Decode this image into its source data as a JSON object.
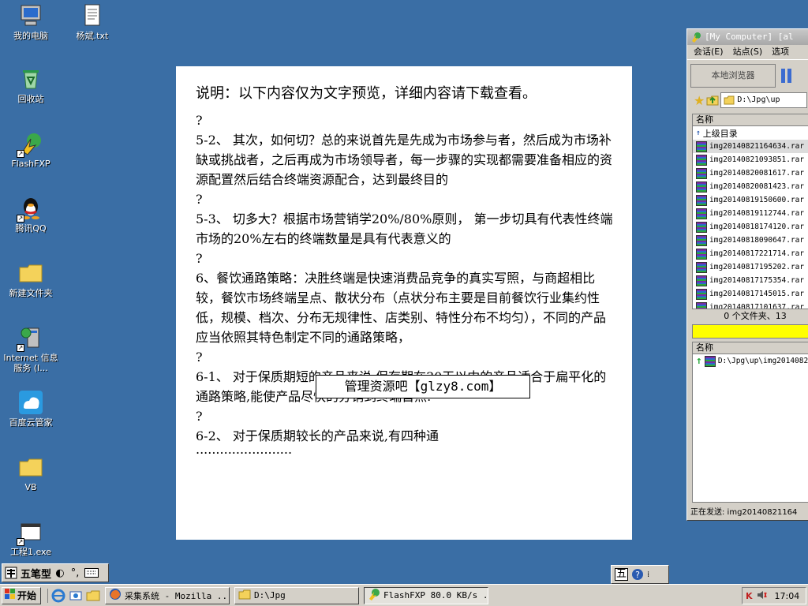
{
  "desktop": {
    "icons": [
      {
        "label": "我的电脑"
      },
      {
        "label": "杨斌.txt"
      },
      {
        "label": "回收站"
      },
      {
        "label": "FlashFXP"
      },
      {
        "label": "腾讯QQ"
      },
      {
        "label": "新建文件夹"
      },
      {
        "label": "Internet 信息服务 (I..."
      },
      {
        "label": "百度云管家"
      },
      {
        "label": "VB"
      },
      {
        "label": "工程1.exe"
      }
    ]
  },
  "document": {
    "header": "说明：以下内容仅为文字预览，详细内容请下载查看。",
    "paragraphs": [
      "?",
      "5-2、 其次，如何切？总的来说首先是先成为市场参与者，然后成为市场补缺或挑战者，之后再成为市场领导者，每一步骤的实现都需要准备相应的资源配置然后结合终端资源配合，达到最终目的",
      "?",
      "5-3、 切多大？根据市场营销学20%/80%原则， 第一步切具有代表性终端市场的20%左右的终端数量是具有代表意义的",
      "?",
      "6、餐饮通路策略：决胜终端是快速消费品竞争的真实写照，与商超相比较，餐饮市场终端呈点、散状分布（点状分布主要是目前餐饮行业集约性低，规模、档次、分布无规律性、店类别、特性分布不均匀），不同的产品应当依照其特色制定不同的通路策略，",
      "?",
      "6-1、 对于保质期短的产品来说,保存期在30天以内的产品适合于扁平化的通路策略,能使产品尽快的分销到终端首点.",
      "?",
      "6-2、 对于保质期较长的产品来说,有四种通",
      "........................"
    ],
    "watermark": "管理资源吧【glzy8.com】"
  },
  "flashfxp": {
    "title": "[My Computer]  [al",
    "menu": [
      "会话(E)",
      "站点(S)",
      "选项"
    ],
    "local_browser": "本地浏览器",
    "path": "D:\\Jpg\\up",
    "column_name": "名称",
    "parent_dir": "上级目录",
    "files": [
      "img20140821164634.rar",
      "img20140821093851.rar",
      "img20140820081617.rar",
      "img20140820081423.rar",
      "img20140819150600.rar",
      "img20140819112744.rar",
      "img20140818174120.rar",
      "img20140818090647.rar",
      "img20140817221714.rar",
      "img20140817195202.rar",
      "img20140817175354.rar",
      "img20140817145015.rar",
      "img20140817101637.rar"
    ],
    "status": "0 个文件夹、13",
    "queue_column": "名称",
    "queue_item": "D:\\Jpg\\up\\img2014082",
    "sending": "正在发送: img20140821164"
  },
  "ime": {
    "label": "五笔型"
  },
  "taskbar": {
    "start": "开始",
    "tasks": [
      {
        "label": "采集系统 - Mozilla ..."
      },
      {
        "label": "D:\\Jpg"
      },
      {
        "label": "FlashFXP 80.0 KB/s ..."
      }
    ],
    "clock": "17:04"
  },
  "colors": {
    "desktop": "#3a6ea5",
    "progress": "#ffff00"
  }
}
